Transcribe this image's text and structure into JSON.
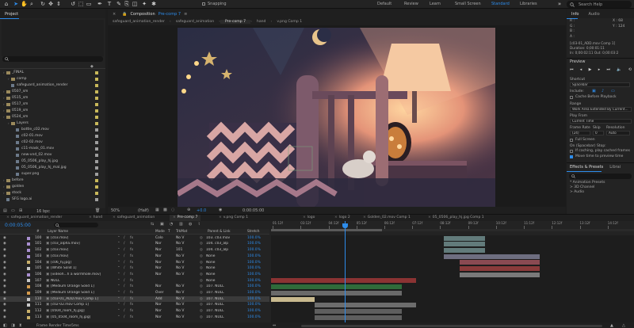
{
  "toolbar": {
    "snapping": "Snapping",
    "workspaces": [
      "Default",
      "Review",
      "Learn",
      "Small Screen",
      "Standard",
      "Libraries"
    ],
    "active_workspace": "Standard",
    "search_placeholder": "Search Help"
  },
  "project": {
    "tab": "Project",
    "items": [
      {
        "label": "_FINAL",
        "type": "folder",
        "color": "#c8b85a"
      },
      {
        "label": "comp",
        "type": "folder",
        "color": "#c8b85a"
      },
      {
        "label": "safeguard_animation_render",
        "type": "file",
        "color": "#c8b85a"
      },
      {
        "label": "0507_sm",
        "type": "folder",
        "color": "#c8b85a"
      },
      {
        "label": "0515_sm",
        "type": "folder",
        "color": "#c8b85a"
      },
      {
        "label": "0517_sm",
        "type": "folder",
        "color": "#c8b85a"
      },
      {
        "label": "0519_sm",
        "type": "folder",
        "color": "#c8b85a"
      },
      {
        "label": "0524_sm",
        "type": "folder",
        "color": "#c8b85a"
      },
      {
        "label": "Layers",
        "type": "folder",
        "color": "#c8b85a"
      },
      {
        "label": "bottle_c02.mov",
        "type": "file",
        "color": "#9e9e9e"
      },
      {
        "label": "c02-01.mov",
        "type": "file",
        "color": "#9e9e9e"
      },
      {
        "label": "c02-02.mov",
        "type": "file",
        "color": "#9e9e9e"
      },
      {
        "label": "c11-mask_01.mov",
        "type": "file",
        "color": "#9e9e9e"
      },
      {
        "label": "new-vnd_02.mov",
        "type": "file",
        "color": "#9e9e9e"
      },
      {
        "label": "05_0506_play_hj.jpg",
        "type": "file",
        "color": "#9e9e9e"
      },
      {
        "label": "05_0506_play_hj_mal.jpg",
        "type": "file",
        "color": "#9e9e9e"
      },
      {
        "label": "super.png",
        "type": "file",
        "color": "#9e9e9e"
      },
      {
        "label": "before",
        "type": "folder",
        "color": "#c8b85a"
      },
      {
        "label": "golden",
        "type": "folder",
        "color": "#c8b85a"
      },
      {
        "label": "stock",
        "type": "folder",
        "color": "#c8b85a"
      },
      {
        "label": "SFG logo.ai",
        "type": "file",
        "color": "#9e9e9e"
      }
    ],
    "bpc": "16 bpc"
  },
  "viewer": {
    "panel_tab": "Composition",
    "comp_name": "Pre-comp 7",
    "breadcrumbs": [
      "safeguard_animation_render",
      "safeguard_animation",
      "Pre-comp 7",
      "hand",
      "v.png Comp 1"
    ],
    "active_breadcrumb": "Pre-comp 7",
    "zoom": "50%",
    "resolution": "(Half)",
    "exposure": "+0.0",
    "timecode": "0:00:05:00"
  },
  "info": {
    "tabs": [
      "Info",
      "Audio"
    ],
    "rgba": [
      "R :",
      "G :",
      "B :",
      "A :"
    ],
    "x": "X : 68",
    "y": "Y : 124",
    "layer_name": "[c03-01_ADD.mov Comp 1]",
    "duration": "Duration: 0;00:01:11",
    "in_out": "In: 0;00:02:11  Out: 0;00:03:2"
  },
  "preview": {
    "title": "Preview",
    "shortcut_label": "Shortcut",
    "shortcut_value": "Spacebar",
    "include_label": "Include:",
    "cache": "Cache Before Playback",
    "range_label": "Range",
    "range_value": "Work Area Extended By Current...",
    "play_from_label": "Play From",
    "play_from_value": "Current Time",
    "frame_rate_label": "Frame Rate",
    "skip_label": "Skip",
    "resolution_label": "Resolution",
    "frame_rate_value": "(24)",
    "skip_value": "0",
    "resolution_value": "Auto",
    "full_screen": "Full Screen",
    "on_stop_label": "On (Spacebar) Stop:",
    "if_caching": "If caching, play cached frames",
    "move_time": "Move time to preview time"
  },
  "effects": {
    "tabs": [
      "Effects & Presets",
      "Librai"
    ],
    "items": [
      "* Animation Presets",
      "> 3D Channel",
      "> Audio"
    ]
  },
  "timeline": {
    "tabs": [
      "safeguard_animation_render",
      "hand",
      "safeguard_animation",
      "Pre-comp 7",
      "v.png Comp 1",
      "logo",
      "logo 2",
      "Golden_02.mov Comp 1",
      "05_0506_play_hj.jpg Comp 1"
    ],
    "active_tab": "Pre-comp 7",
    "timecode": "0:00:05:00",
    "column_headers": [
      "#",
      "Layer Name",
      "Mode",
      "T",
      "TrkMat",
      "Parent & Link",
      "Stretch"
    ],
    "ruler": [
      "01:12f",
      "03:12f",
      "04:12f",
      "05:12f",
      "06:12f",
      "07:12f",
      "08:12f",
      "09:12f",
      "10:12f",
      "11:12f",
      "12:12f",
      "13:12f",
      "14:12f"
    ],
    "render_label": "Frame Render Time",
    "render_time": "5ms",
    "layers": [
      {
        "num": "100",
        "name": "[c03.mov]",
        "mode": "Colo",
        "trk": "No V",
        "parent": "103. c03.mov",
        "stretch": "100.0%",
        "color": "#a98fd0",
        "bar": [
          0.475,
          0.59
        ],
        "barc": "#627b7b"
      },
      {
        "num": "101",
        "name": "[c03_alpha.mov]",
        "mode": "Nor",
        "trk": "No V",
        "parent": "104. c03_alp",
        "stretch": "100.0%",
        "color": "#a98fd0",
        "bar": [
          0.475,
          0.59
        ],
        "barc": "#627b7b"
      },
      {
        "num": "102",
        "name": "[c03.mov]",
        "mode": "Nor",
        "trk": "101",
        "parent": "104. c03_alp",
        "stretch": "100.0%",
        "color": "#a98fd0",
        "bar": [
          0.475,
          0.59
        ],
        "barc": "#627b7b"
      },
      {
        "num": "103",
        "name": "[c03.mov]",
        "mode": "Nor",
        "trk": "No V",
        "parent": "None",
        "stretch": "100.0%",
        "color": "#a98fd0",
        "bar": [
          0.475,
          0.74
        ],
        "barc": "#6e6e80"
      },
      {
        "num": "104",
        "name": "[c06_hj.jpg]",
        "mode": "Nor",
        "trk": "No V",
        "parent": "None",
        "stretch": "100.0%",
        "color": "#c9b06a",
        "bar": [
          0.52,
          0.74
        ],
        "barc": "#8a4a52"
      },
      {
        "num": "105",
        "name": "[White Solid 1]",
        "mode": "Nor",
        "trk": "No V",
        "parent": "None",
        "stretch": "100.0%",
        "color": "#c8c8c8",
        "bar": [
          0.52,
          0.74
        ],
        "barc": "#8a3b3b"
      },
      {
        "num": "106",
        "name": "[videoh...h a wormhole.mov]",
        "mode": "Nor",
        "trk": "No V",
        "parent": "None",
        "stretch": "100.0%",
        "color": "#a98fd0",
        "bar": [
          0.52,
          0.74
        ],
        "barc": "#7a7a7a"
      },
      {
        "num": "107",
        "name": "NULL",
        "mode": "",
        "trk": "",
        "parent": "None",
        "stretch": "100.0%",
        "color": "#c8c8c8",
        "bar": [
          0.0,
          0.4
        ],
        "barc": "#8b3333"
      },
      {
        "num": "108",
        "name": "[Medium Orange Solid 1]",
        "mode": "Nor",
        "trk": "No V",
        "parent": "107. NULL",
        "stretch": "100.0%",
        "color": "#d49a4c",
        "bar": [
          0.0,
          0.36
        ],
        "barc": "#2f6b3a"
      },
      {
        "num": "109",
        "name": "[Medium Orange Solid 1]",
        "mode": "Over",
        "trk": "No V",
        "parent": "107. NULL",
        "stretch": "100.0%",
        "color": "#d49a4c",
        "bar": [
          0.0,
          0.36
        ],
        "barc": "#6a6a6a"
      },
      {
        "num": "110",
        "name": "[c03-01_ADD.mov Comp 1]",
        "mode": "Add",
        "trk": "No V",
        "parent": "107. NULL",
        "stretch": "100.0%",
        "color": "#c8c8c8",
        "bar": [
          0.0,
          0.12
        ],
        "barc": "#c8b98e",
        "selected": true
      },
      {
        "num": "111",
        "name": "[c02-02.mov Comp 1]",
        "mode": "Nor",
        "trk": "No V",
        "parent": "107. NULL",
        "stretch": "100.0%",
        "color": "#c8c8c8",
        "bar": [
          0.12,
          0.4
        ],
        "barc": "#6d6d6d"
      },
      {
        "num": "112",
        "name": "[0504_room_hj.jpg]",
        "mode": "Nor",
        "trk": "No V",
        "parent": "107. NULL",
        "stretch": "100.0%",
        "color": "#c9b06a",
        "bar": [
          0.12,
          0.36
        ],
        "barc": "#5e5e5e"
      },
      {
        "num": "113",
        "name": "[05_0504_room_hj.jpg]",
        "mode": "Nor",
        "trk": "No V",
        "parent": "107. NULL",
        "stretch": "100.0%",
        "color": "#c9b06a",
        "bar": [
          0.12,
          0.36
        ],
        "barc": "#5e5e5e"
      }
    ]
  }
}
